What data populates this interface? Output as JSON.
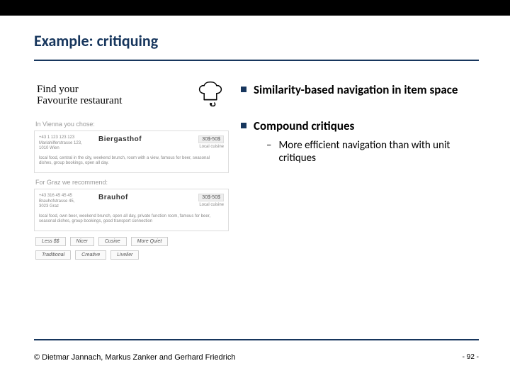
{
  "title": "Example: critiquing",
  "example": {
    "header_line1": "Find your",
    "header_line2": "Favourite restaurant",
    "section_vienna": "In Vienna you chose:",
    "card_vienna": {
      "phone": "+43 1 123 123 123",
      "street": "Mariahilferstrasse 123,",
      "city": "1010 Wien",
      "name": "Biergasthof",
      "price": "30$-50$",
      "cuisine": "Local cuisine",
      "desc": "local food, central in the city, weekend brunch, room with a view, famous for beer, seasonal dishes, group bookings, open all day."
    },
    "section_graz": "For Graz we recommend:",
    "card_graz": {
      "phone": "+43 316 45 45 45",
      "street": "Brauhofstrasse 45,",
      "city": "3023 Graz",
      "name": "Brauhof",
      "price": "30$-50$",
      "cuisine": "Local cuisine",
      "desc": "local food, own beer, weekend brunch, open all day, private function room, famous for beer, seasonal dishes, group bookings, good transport connection"
    },
    "chips_row1": [
      "Less $$",
      "Nicer",
      "Cusine",
      "More Quiet"
    ],
    "chips_row2": [
      "Traditional",
      "Creative",
      "Livelier"
    ]
  },
  "bullets": {
    "b1": "Similarity-based navigation in item space",
    "b2": "Compound critiques",
    "b2_sub": "More efficient navigation than with unit critiques"
  },
  "footer": "© Dietmar Jannach, Markus Zanker and Gerhard Friedrich",
  "page": "- 92 -"
}
